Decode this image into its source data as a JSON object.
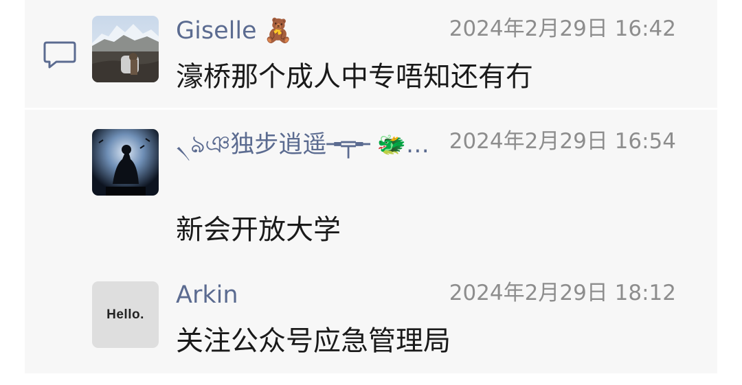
{
  "comments": [
    {
      "name": "Giselle",
      "name_emoji": "🧸",
      "time": "2024年2月29日 16:42",
      "message": "濠桥那个成人中专唔知还有冇"
    },
    {
      "name": "৲ঌঞ独步逍遥╼╤╾",
      "name_emoji": "🐲…",
      "time": "2024年2月29日 16:54",
      "message": "新会开放大学"
    },
    {
      "name": "Arkin",
      "name_emoji": "",
      "time": "2024年2月29日 18:12",
      "message": "关注公众号应急管理局",
      "avatar_text": "Hello."
    }
  ],
  "colors": {
    "name": "#5b6b90",
    "time": "#8d8d8d",
    "message": "#1a1a1a",
    "panel_bg": "#f7f7f7"
  },
  "icons": {
    "section_icon": "comment-icon"
  }
}
